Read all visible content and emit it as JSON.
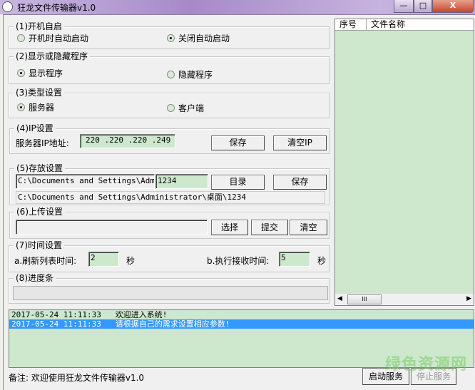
{
  "window": {
    "title": "狂龙文件传输器v1.0",
    "minimize": "—",
    "maximize": "□",
    "close": "X"
  },
  "g1": {
    "title": "(1)开机自启",
    "opt1": "开机时自动启动",
    "opt2": "关闭自动启动",
    "selected": "opt2"
  },
  "g2": {
    "title": "(2)显示或隐藏程序",
    "opt1": "显示程序",
    "opt2": "隐藏程序",
    "selected": "opt1"
  },
  "g3": {
    "title": "(3)类型设置",
    "opt1": "服务器",
    "opt2": "客户端",
    "selected": "opt1"
  },
  "g4": {
    "title": "(4)IP设置",
    "label": "服务器IP地址:",
    "ip": "220 .220 .220 .249",
    "save": "保存",
    "clear": "清空IP"
  },
  "g5": {
    "title": "(5)存放设置",
    "path": "C:\\Documents and Settings\\Administrator\\桌面",
    "folder": "1234",
    "dir": "目录",
    "save": "保存",
    "fullpath": "C:\\Documents and Settings\\Administrator\\桌面\\1234"
  },
  "g6": {
    "title": "(6)上传设置",
    "file": "",
    "select": "选择",
    "submit": "提交",
    "clear": "清空"
  },
  "g7": {
    "title": "(7)时间设置",
    "a_label": "a.刷新列表时间:",
    "a_value": "2",
    "a_unit": "秒",
    "b_label": "b.执行接收时间:",
    "b_value": "5",
    "b_unit": "秒"
  },
  "g8": {
    "title": "(8)进度条",
    "progress": 0
  },
  "filelist": {
    "columns": [
      "序号",
      "文件名称"
    ],
    "scroll_thumb": "III"
  },
  "log": [
    {
      "time": "2017-05-24 11:11:33",
      "msg": "欢迎进入系统!"
    },
    {
      "time": "2017-05-24 11:11:33",
      "msg": "请根据自己的需求设置相应参数!"
    }
  ],
  "footer": {
    "note": "备注: 欢迎使用狂龙文件传输器v1.0",
    "start": "启动服务",
    "stop": "停止服务"
  },
  "watermark": "绿色资源网"
}
